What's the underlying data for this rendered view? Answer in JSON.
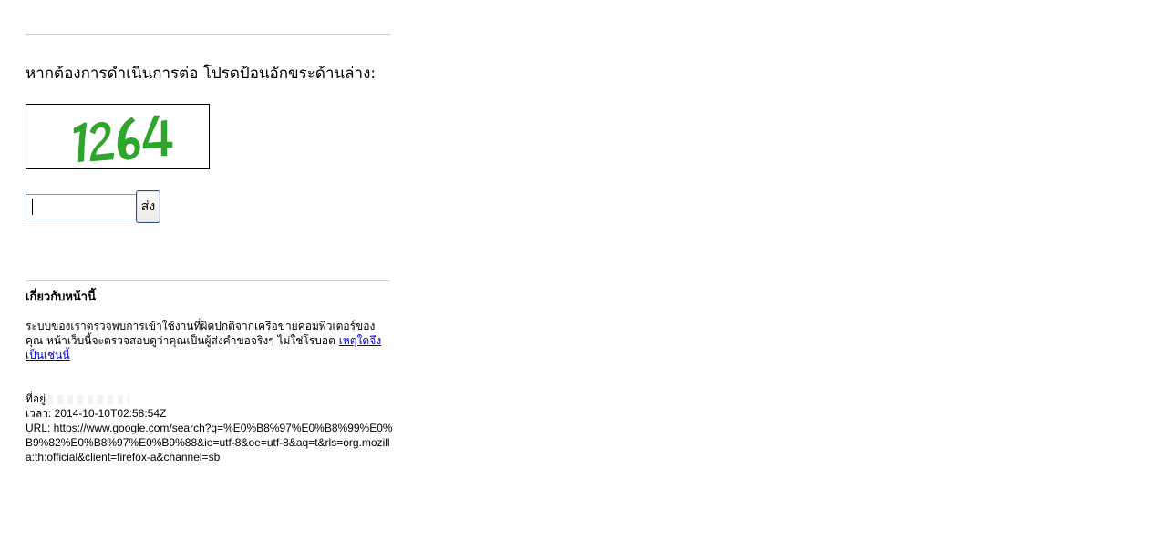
{
  "prompt": {
    "text": "หากต้องการดำเนินการต่อ โปรดป้อนอักขระด้านล่าง:"
  },
  "captcha": {
    "characters": "1264",
    "color": "#2ea52c"
  },
  "form": {
    "input_value": "",
    "submit_label": "ส่ง"
  },
  "about": {
    "title": "เกี่ยวกับหน้านี้",
    "body": "ระบบของเราตรวจพบการเข้าใช้งานที่ผิดปกติจากเครือข่ายคอมพิวเตอร์ของคุณ หน้าเว็บนี้จะตรวจสอบดูว่าคุณเป็นผู้ส่งคำขอจริงๆ ไม่ใช่โรบอต",
    "link_text": "เหตุใดจึงเป็นเช่นนี้"
  },
  "details": {
    "ip_label": "ที่อยู่",
    "time_line": "เวลา: 2014-10-10T02:58:54Z",
    "url_line": "URL: https://www.google.com/search?q=%E0%B8%97%E0%B8%99%E0%B9%82%E0%B8%97%E0%B9%88&ie=utf-8&oe=utf-8&aq=t&rls=org.mozilla:th:official&client=firefox-a&channel=sb"
  },
  "colors": {
    "captcha_text": "#2ea52c",
    "link": "#0000cc",
    "rule": "#cccccc",
    "input_border": "#7f9db9",
    "button_border": "#2c4f8a"
  }
}
